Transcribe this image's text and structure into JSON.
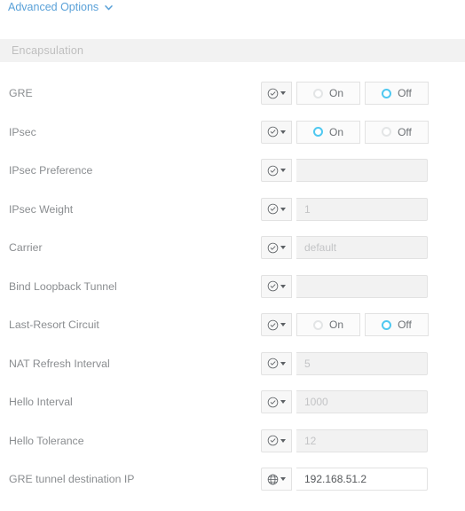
{
  "advanced_options": {
    "label": "Advanced Options",
    "chevron_icon": "chevron-down-icon"
  },
  "section": {
    "title": "Encapsulation"
  },
  "colors": {
    "link": "#5aa1d8",
    "accent_selected": "#4fc8f0",
    "label_text": "#8a8d90",
    "section_bg": "#f2f2f2",
    "input_disabled_bg": "#f2f2f2",
    "border": "#e2e2e2"
  },
  "radio_labels": {
    "on": "On",
    "off": "Off"
  },
  "rows": [
    {
      "label": "GRE",
      "icon": "circle-check-icon",
      "control": "radio",
      "on_label": "On",
      "off_label": "Off",
      "selected": "Off"
    },
    {
      "label": "IPsec",
      "icon": "circle-check-icon",
      "control": "radio",
      "on_label": "On",
      "off_label": "Off",
      "selected": "On"
    },
    {
      "label": "IPsec Preference",
      "icon": "circle-check-icon",
      "control": "input",
      "value": "",
      "placeholder": "",
      "state": "disabled"
    },
    {
      "label": "IPsec Weight",
      "icon": "circle-check-icon",
      "control": "input",
      "value": "",
      "placeholder": "1",
      "state": "disabled"
    },
    {
      "label": "Carrier",
      "icon": "circle-check-icon",
      "control": "input",
      "value": "",
      "placeholder": "default",
      "state": "disabled"
    },
    {
      "label": "Bind Loopback Tunnel",
      "icon": "circle-check-icon",
      "control": "input",
      "value": "",
      "placeholder": "",
      "state": "disabled"
    },
    {
      "label": "Last-Resort Circuit",
      "icon": "circle-check-icon",
      "control": "radio",
      "on_label": "On",
      "off_label": "Off",
      "selected": "Off"
    },
    {
      "label": "NAT Refresh Interval",
      "icon": "circle-check-icon",
      "control": "input",
      "value": "",
      "placeholder": "5",
      "state": "disabled"
    },
    {
      "label": "Hello Interval",
      "icon": "circle-check-icon",
      "control": "input",
      "value": "",
      "placeholder": "1000",
      "state": "disabled"
    },
    {
      "label": "Hello Tolerance",
      "icon": "circle-check-icon",
      "control": "input",
      "value": "",
      "placeholder": "12",
      "state": "disabled"
    },
    {
      "label": "GRE tunnel destination IP",
      "icon": "globe-icon",
      "control": "input",
      "value": "192.168.51.2",
      "placeholder": "",
      "state": "active"
    }
  ]
}
